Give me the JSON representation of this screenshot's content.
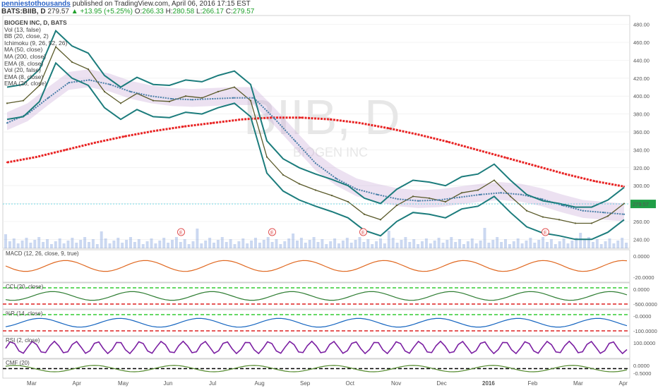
{
  "header": {
    "author": "penniestothousands",
    "published": "published on TradingView.com, April 06, 2016 17:15 EST",
    "symbol": "BATS:BIIB, D",
    "last": "279.57",
    "change": "+13.95 (+5.25%)",
    "o_label": "O:",
    "o_value": "266.33",
    "h_label": "H:",
    "h_value": "280.58",
    "l_label": "L:",
    "l_value": "266.17",
    "c_label": "C:",
    "c_value": "279.57"
  },
  "indicators": [
    "BIOGEN INC, D, BATS",
    "Vol (13, false)",
    "BB (20, close, 2)",
    "Ichimoku (9, 26, 52, 26)",
    "MA (50, close)",
    "MA (200, close)",
    "EMA (8, close)",
    "Vol (20, false)",
    "EMA (8, close)",
    "EMA (20, close)"
  ],
  "watermark": {
    "ticker": "BIIB, D",
    "company": "BIOGEN INC"
  },
  "last_price_tag": "279.57",
  "earnings_marker": "E",
  "colors": {
    "background": "#ffffff",
    "accent_price_line": "#26c6da",
    "ma200": "#e82424",
    "ma50": "#4a7fa8",
    "bollinger": "#1c7c7c",
    "ema8": "#e02bcb",
    "cloud": "#c9a8d6",
    "volume": "#6b8fd6"
  },
  "subpanels": [
    {
      "label": "MACD (12, 26, close, 9, true)",
      "ticks": [
        "0.0000",
        "-20.0000"
      ]
    },
    {
      "label": "CCI (20, close)",
      "ticks": [
        "0.0000",
        "-500.0000"
      ]
    },
    {
      "label": "%R (14, close)",
      "ticks": [
        "-0.0000",
        "-100.0000"
      ]
    },
    {
      "label": "RSI (2, close)",
      "ticks": [
        "100.0000"
      ]
    },
    {
      "label": "CMF (20)",
      "ticks": [
        "0.0000",
        "-0.5000"
      ]
    }
  ],
  "chart_data": {
    "type": "line",
    "title": "BIOGEN INC, D, BATS",
    "xlabel": "",
    "ylabel": "",
    "ylim": [
      230,
      490
    ],
    "price_ticks": [
      240,
      260,
      280,
      300,
      320,
      340,
      360,
      380,
      400,
      420,
      440,
      460,
      480
    ],
    "price_tick_labels": [
      "240.00",
      "260.00",
      "280.00",
      "300.00",
      "320.00",
      "340.00",
      "360.00",
      "380.00",
      "400.00",
      "420.00",
      "440.00",
      "460.00",
      "480.00"
    ],
    "x_labels": [
      "Mar",
      "Apr",
      "May",
      "Jun",
      "Jul",
      "Aug",
      "Sep",
      "Oct",
      "Nov",
      "Dec",
      "2016",
      "Feb",
      "Mar",
      "Apr"
    ],
    "series": [
      {
        "name": "MA (200, close)",
        "values": [
          326,
          332,
          340,
          348,
          355,
          361,
          366,
          370,
          374,
          376,
          376,
          374,
          370,
          364,
          357,
          349,
          340,
          331,
          322,
          313,
          305,
          299
        ]
      },
      {
        "name": "Close",
        "values": [
          392,
          395,
          412,
          455,
          438,
          430,
          405,
          392,
          403,
          395,
          394,
          400,
          398,
          405,
          410,
          395,
          332,
          312,
          302,
          295,
          289,
          282,
          268,
          262,
          278,
          288,
          286,
          282,
          292,
          295,
          306,
          288,
          272,
          265,
          262,
          258,
          258,
          266,
          280
        ]
      },
      {
        "name": "MA (50, close)",
        "values": [
          370,
          380,
          398,
          415,
          418,
          413,
          405,
          400,
          397,
          396,
          397,
          398,
          398,
          375,
          350,
          325,
          308,
          296,
          290,
          285,
          283,
          284,
          287,
          290,
          292,
          290,
          285,
          278,
          272,
          270,
          268
        ]
      }
    ],
    "earnings_dates": [
      "May",
      "Aug",
      "Oct",
      "Feb"
    ],
    "last_value": 279.57
  }
}
